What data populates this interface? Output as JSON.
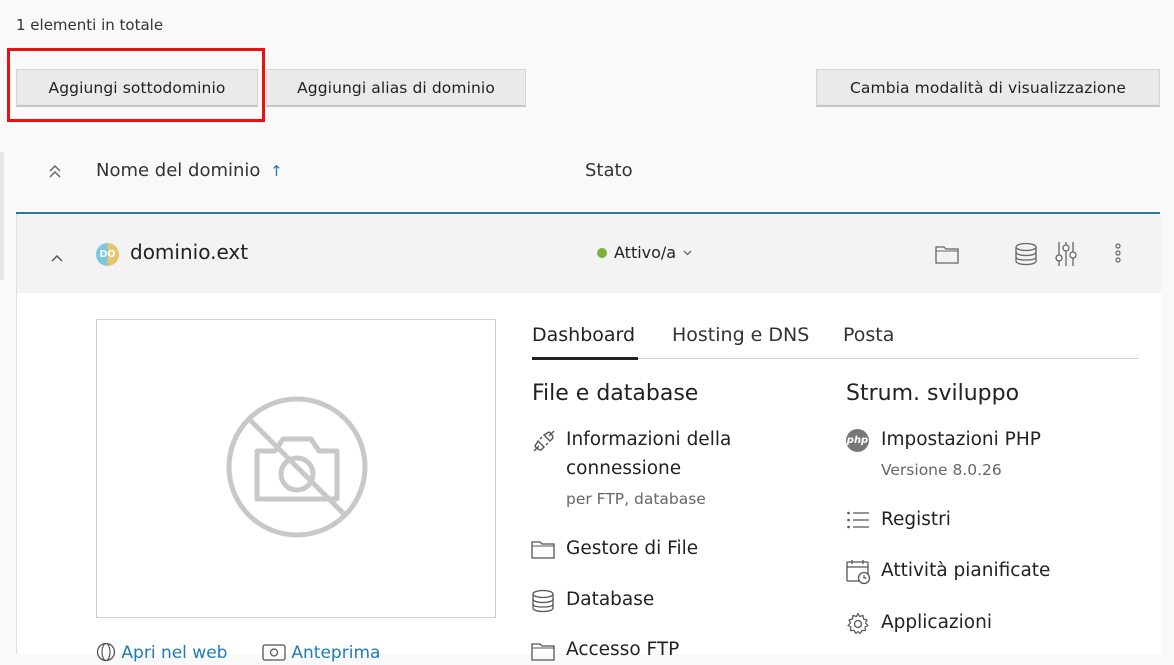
{
  "list": {
    "total_label": "1 elementi in totale"
  },
  "toolbar": {
    "add_subdomain": "Aggiungi sottodominio",
    "add_alias": "Aggiungi alias di dominio",
    "change_view": "Cambia modalità di visualizzazione"
  },
  "table": {
    "col_name": "Nome del dominio",
    "sort_indicator": "↑",
    "col_status": "Stato"
  },
  "domain": {
    "avatar_text": "DO",
    "name": "dominio.ext",
    "status": "Attivo/a",
    "status_color": "#7bb33a"
  },
  "tabs": [
    "Dashboard",
    "Hosting e DNS",
    "Posta"
  ],
  "files_section": {
    "title": "File e database",
    "items": [
      {
        "label_line1": "Informazioni della",
        "label_line2": "connessione",
        "sub": "per FTP, database",
        "icon": "plug-icon"
      },
      {
        "label": "Gestore di File",
        "icon": "folder-icon"
      },
      {
        "label": "Database",
        "icon": "database-icon"
      },
      {
        "label": "Accesso FTP",
        "icon": "folder-icon"
      }
    ]
  },
  "dev_section": {
    "title": "Strum. sviluppo",
    "items": [
      {
        "label": "Impostazioni PHP",
        "sub": "Versione 8.0.26",
        "icon": "php-icon",
        "icon_text": "php"
      },
      {
        "label": "Registri",
        "icon": "list-icon"
      },
      {
        "label": "Attività pianificate",
        "icon": "calendar-clock-icon"
      },
      {
        "label": "Applicazioni",
        "icon": "gear-icon"
      }
    ]
  },
  "preview_links": {
    "open_web": "Apri nel web",
    "preview": "Anteprima"
  },
  "colors": {
    "accent": "#28799e",
    "link": "#1f7bb6",
    "highlight": "#e81010"
  }
}
